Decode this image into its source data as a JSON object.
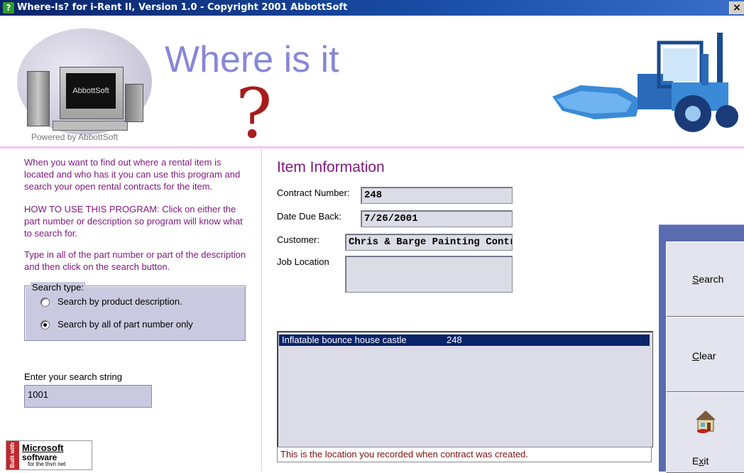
{
  "window": {
    "title": "Where-Is? for i-Rent II, Version 1.0 - Copyright 2001 AbbottSoft",
    "close_glyph": "×"
  },
  "header": {
    "logo_screen_text": "AbbottSoft",
    "powered_by": "Powered by AbbottSoft",
    "title": "Where is it",
    "question_mark": "?"
  },
  "instructions": {
    "p1": "When you want to find out where a rental item is located and who has it you can use this program and search your open rental contracts for the item.",
    "p2": "HOW TO USE THIS PROGRAM:  Click on either the part number or description so program will know what to search for.",
    "p3": "Type in all of the part number or part of the description and then click on the search button."
  },
  "search_type": {
    "legend": "Search type:",
    "options": [
      {
        "label": "Search by product description.",
        "selected": false
      },
      {
        "label": "Search by all of part number only",
        "selected": true
      }
    ]
  },
  "search": {
    "label": "Enter your search string",
    "value": "1001"
  },
  "item_info": {
    "heading": "Item Information",
    "contract_number_label": "Contract Number:",
    "contract_number": "248",
    "date_due_label": "Date Due Back:",
    "date_due": "7/26/2001",
    "customer_label": "Customer:",
    "customer": "Chris & Barge Painting Contrac",
    "job_location_label": "Job Location",
    "job_location": ""
  },
  "results": [
    {
      "description": "Inflatable bounce house castle",
      "contract": "248"
    }
  ],
  "status_text": "This is the location you recorded when contract was created.",
  "buttons": {
    "search": {
      "pre": "",
      "key": "S",
      "post": "earch"
    },
    "clear": {
      "pre": "",
      "key": "C",
      "post": "lear"
    },
    "exit": {
      "pre": "E",
      "key": "x",
      "post": "it"
    }
  },
  "badge": {
    "built_with": "Built with",
    "brand": "Microsoft",
    "product": "software",
    "tagline": "for the thvn net"
  },
  "colors": {
    "title_accent": "#8787d9",
    "instruction_text": "#801a80",
    "question_mark": "#a81c1c",
    "panel_blue": "#5a6cb0",
    "selection": "#0a246a",
    "machine": "#3a8ad8"
  },
  "icons": [
    "app-help-icon",
    "close-icon",
    "computer-logo-icon",
    "loader-machine-icon",
    "house-exit-icon",
    "radio-icon"
  ]
}
